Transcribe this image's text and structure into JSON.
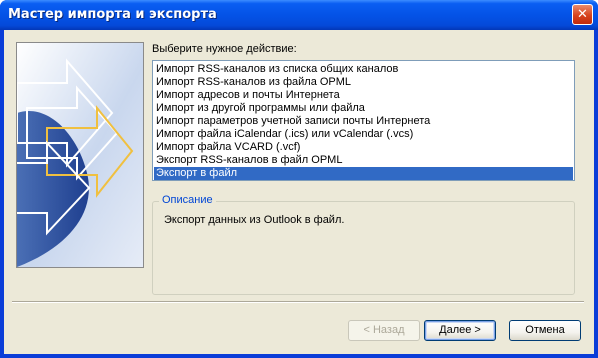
{
  "window": {
    "title": "Мастер импорта и экспорта",
    "close_glyph": "✕"
  },
  "prompt": "Выберите нужное действие:",
  "actions": [
    {
      "label": "Импорт RSS-каналов из списка общих каналов",
      "selected": false
    },
    {
      "label": "Импорт RSS-каналов из файла OPML",
      "selected": false
    },
    {
      "label": "Импорт адресов и почты Интернета",
      "selected": false
    },
    {
      "label": "Импорт из другой программы или файла",
      "selected": false
    },
    {
      "label": "Импорт параметров учетной записи почты Интернета",
      "selected": false
    },
    {
      "label": "Импорт файла iCalendar (.ics) или vCalendar (.vcs)",
      "selected": false
    },
    {
      "label": "Импорт файла VCARD (.vcf)",
      "selected": false
    },
    {
      "label": "Экспорт RSS-каналов в файл OPML",
      "selected": false
    },
    {
      "label": "Экспорт в файл",
      "selected": true
    }
  ],
  "description": {
    "title": "Описание",
    "text": "Экспорт данных из Outlook в файл."
  },
  "buttons": {
    "back": "< Назад",
    "next": "Далее >",
    "cancel": "Отмена"
  },
  "colors": {
    "titlebar": "#0453e7",
    "selection": "#316ac5",
    "group_title": "#0046d5"
  }
}
